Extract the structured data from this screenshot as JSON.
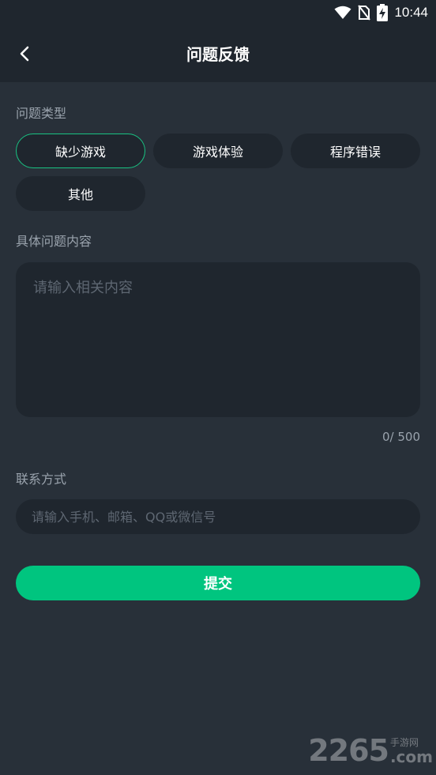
{
  "status_bar": {
    "time": "10:44",
    "icons": [
      "wifi-icon",
      "no-sim-icon",
      "battery-charging-icon"
    ]
  },
  "header": {
    "back_icon": "chevron-left-icon",
    "title": "问题反馈"
  },
  "issue_type": {
    "label": "问题类型",
    "options": [
      {
        "label": "缺少游戏",
        "selected": true
      },
      {
        "label": "游戏体验",
        "selected": false
      },
      {
        "label": "程序错误",
        "selected": false
      },
      {
        "label": "其他",
        "selected": false
      }
    ]
  },
  "content": {
    "label": "具体问题内容",
    "value": "",
    "placeholder": "请输入相关内容",
    "counter": "0/ 500"
  },
  "contact": {
    "label": "联系方式",
    "value": "",
    "placeholder": "请输入手机、邮箱、QQ或微信号"
  },
  "submit": {
    "label": "提交"
  },
  "watermark": {
    "number": "2265",
    "cn": "手游网",
    "suffix": ".com"
  },
  "colors": {
    "background": "#283039",
    "surface": "#1f262e",
    "accent": "#00c57f",
    "selected_border": "#19c282",
    "muted_text": "#9aa3ad"
  }
}
